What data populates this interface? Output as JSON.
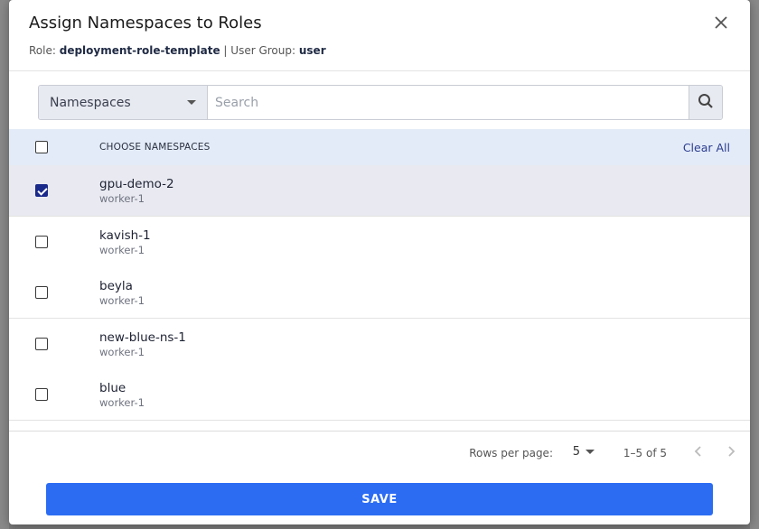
{
  "modal": {
    "title": "Assign Namespaces to Roles",
    "role_label": "Role:",
    "role_value": "deployment-role-template",
    "separator": "|",
    "group_label": "User Group:",
    "group_value": "user"
  },
  "filter": {
    "select_value": "Namespaces",
    "search_placeholder": "Search"
  },
  "table": {
    "header_label": "CHOOSE NAMESPACES",
    "clear_all": "Clear All",
    "rows": [
      {
        "name": "gpu-demo-2",
        "sub": "worker-1",
        "checked": true
      },
      {
        "name": "kavish-1",
        "sub": "worker-1",
        "checked": false
      },
      {
        "name": "beyla",
        "sub": "worker-1",
        "checked": false
      },
      {
        "name": "new-blue-ns-1",
        "sub": "worker-1",
        "checked": false
      },
      {
        "name": "blue",
        "sub": "worker-1",
        "checked": false
      }
    ]
  },
  "pagination": {
    "rows_per_page_label": "Rows per page:",
    "rows_per_page_value": "5",
    "range": "1–5 of 5"
  },
  "actions": {
    "save_label": "SAVE"
  },
  "colors": {
    "primary": "#2b6cf3",
    "checkbox_checked": "#1a2a8a",
    "header_bg": "#e3ebf8",
    "selected_row_bg": "#e9eaf1"
  }
}
